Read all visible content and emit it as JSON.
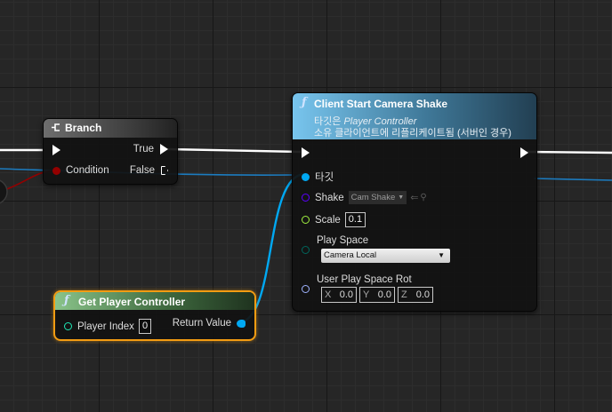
{
  "branch": {
    "title": "Branch",
    "pins": {
      "true_label": "True",
      "condition_label": "Condition",
      "false_label": "False"
    }
  },
  "camera_shake": {
    "title": "Client Start Camera Shake",
    "target_line_prefix": "타깃은",
    "target_class": "Player Controller",
    "desc": "소유 클라이언트에 리플리케이트됨 (서버인 경우)",
    "pins": {
      "target": "타깃",
      "shake": "Shake",
      "shake_value": "Cam Shake",
      "scale": "Scale",
      "scale_value": "0.1",
      "play_space": "Play Space",
      "play_space_value": "Camera Local",
      "rot": "User Play Space Rot",
      "x_label": "X",
      "x_value": "0.0",
      "y_label": "Y",
      "y_value": "0.0",
      "z_label": "Z",
      "z_value": "0.0"
    }
  },
  "get_pc": {
    "title": "Get Player Controller",
    "player_index_label": "Player Index",
    "player_index_value": "0",
    "return_label": "Return Value"
  },
  "icons": {
    "function": "function-icon",
    "branch": "branch-icon"
  },
  "colors": {
    "exec": "#ffffff",
    "bool": "#940000",
    "object": "#00a8f2",
    "class": "#5a00ff",
    "float": "#a0f040",
    "enum": "#00665c",
    "struct": "#9fb3ff",
    "int": "#1ee8b6",
    "branch_header": "#6e6e6e",
    "function_header": "#78c5ee",
    "pure_header": "#8ac48a",
    "selection": "#f39c12"
  }
}
